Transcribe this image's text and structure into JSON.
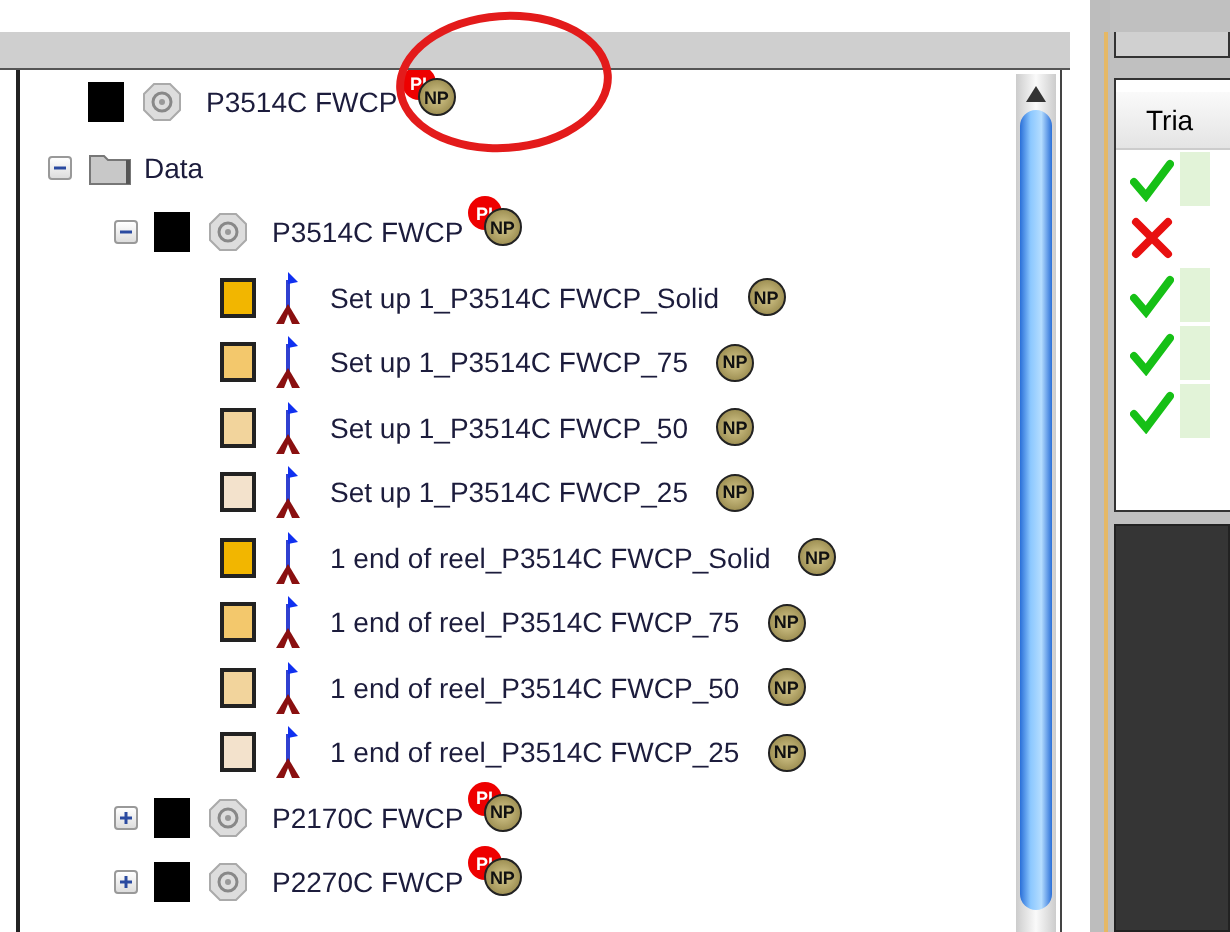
{
  "tree": [
    {
      "kind": "dataset",
      "name": "P3514C FWCP",
      "color": "#000000",
      "badges": [
        {
          "kind": "pi",
          "label": "PI"
        },
        {
          "kind": "np",
          "label": "NP"
        }
      ]
    },
    {
      "kind": "folder",
      "name": "Data",
      "expanded": true,
      "children": [
        {
          "kind": "dataset",
          "name": "P3514C FWCP",
          "color": "#000000",
          "expanded": true,
          "badges": [
            {
              "kind": "pi",
              "label": "PI"
            },
            {
              "kind": "np",
              "label": "NP"
            }
          ],
          "children": [
            {
              "kind": "measurement",
              "name": "Set up 1_P3514C FWCP_Solid",
              "color": "#f2b600",
              "badges": [
                {
                  "kind": "np",
                  "label": "NP"
                }
              ]
            },
            {
              "kind": "measurement",
              "name": "Set up 1_P3514C FWCP_75",
              "color": "#f3c86c",
              "badges": [
                {
                  "kind": "np",
                  "label": "NP"
                }
              ]
            },
            {
              "kind": "measurement",
              "name": "Set up 1_P3514C FWCP_50",
              "color": "#f2d49c",
              "badges": [
                {
                  "kind": "np",
                  "label": "NP"
                }
              ]
            },
            {
              "kind": "measurement",
              "name": "Set up 1_P3514C FWCP_25",
              "color": "#f3e2cc",
              "badges": [
                {
                  "kind": "np",
                  "label": "NP"
                }
              ]
            },
            {
              "kind": "measurement",
              "name": "1 end of reel_P3514C FWCP_Solid",
              "color": "#f2b600",
              "badges": [
                {
                  "kind": "np",
                  "label": "NP"
                }
              ]
            },
            {
              "kind": "measurement",
              "name": "1 end of reel_P3514C FWCP_75",
              "color": "#f3c86c",
              "badges": [
                {
                  "kind": "np",
                  "label": "NP"
                }
              ]
            },
            {
              "kind": "measurement",
              "name": "1 end of reel_P3514C FWCP_50",
              "color": "#f2d49c",
              "badges": [
                {
                  "kind": "np",
                  "label": "NP"
                }
              ]
            },
            {
              "kind": "measurement",
              "name": "1 end of reel_P3514C FWCP_25",
              "color": "#f3e2cc",
              "badges": [
                {
                  "kind": "np",
                  "label": "NP"
                }
              ]
            }
          ]
        },
        {
          "kind": "dataset",
          "name": "P2170C FWCP",
          "color": "#000000",
          "expanded": false,
          "badges": [
            {
              "kind": "pi",
              "label": "PI"
            },
            {
              "kind": "np",
              "label": "NP"
            }
          ]
        },
        {
          "kind": "dataset",
          "name": "P2270C FWCP",
          "color": "#000000",
          "expanded": false,
          "badges": [
            {
              "kind": "pi",
              "label": "PI"
            },
            {
              "kind": "np",
              "label": "NP"
            }
          ]
        }
      ]
    }
  ],
  "results": {
    "header": "Tria",
    "rows": [
      {
        "kind": "pass"
      },
      {
        "kind": "fail"
      },
      {
        "kind": "pass"
      },
      {
        "kind": "pass"
      },
      {
        "kind": "pass"
      }
    ]
  }
}
